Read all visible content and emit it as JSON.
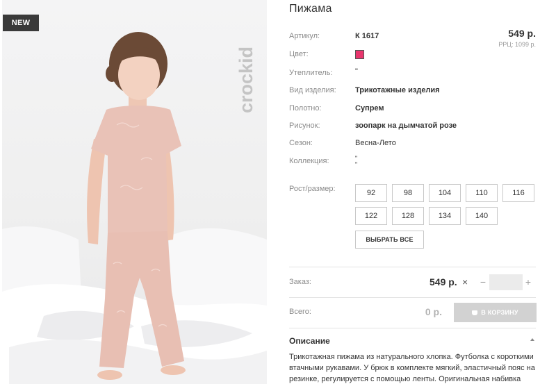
{
  "photo": {
    "badge": "NEW",
    "brand": "crockid"
  },
  "product": {
    "title": "Пижама",
    "price": "549 р.",
    "rrp": "РРЦ: 1099 р.",
    "color_hex": "#e8356d"
  },
  "attributes": [
    {
      "label": "Артикул:",
      "value": "К 1617"
    },
    {
      "label": "Цвет:",
      "value": ""
    },
    {
      "label": "Утеплитель:",
      "value": "\""
    },
    {
      "label": "Вид изделия:",
      "value": "Трикотажные изделия"
    },
    {
      "label": "Полотно:",
      "value": "Супрем"
    },
    {
      "label": "Рисунок:",
      "value": "зоопарк на дымчатой розе"
    },
    {
      "label": "Сезон:",
      "value": "Весна-Лето"
    },
    {
      "label": "Коллекция:",
      "value": "\"\n\""
    }
  ],
  "sizes": {
    "label": "Рост/размер:",
    "options": [
      "92",
      "98",
      "104",
      "110",
      "116",
      "122",
      "128",
      "134",
      "140"
    ],
    "select_all": "ВЫБРАТЬ ВСЕ"
  },
  "order": {
    "label": "Заказ:",
    "price": "549 р.",
    "times": "×",
    "minus": "−",
    "plus": "+",
    "quantity": ""
  },
  "total": {
    "label": "Всего:",
    "value": "0 р.",
    "cart_button": "В КОРЗИНУ"
  },
  "description": {
    "title": "Описание",
    "text": "Трикотажная пижама из натурального хлопка. Футболка с короткими втачными рукавами. У брюк в комплекте мягкий, эластичный пояс на резинке, регулируется с помощью ленты. Оригинальная набивка"
  }
}
